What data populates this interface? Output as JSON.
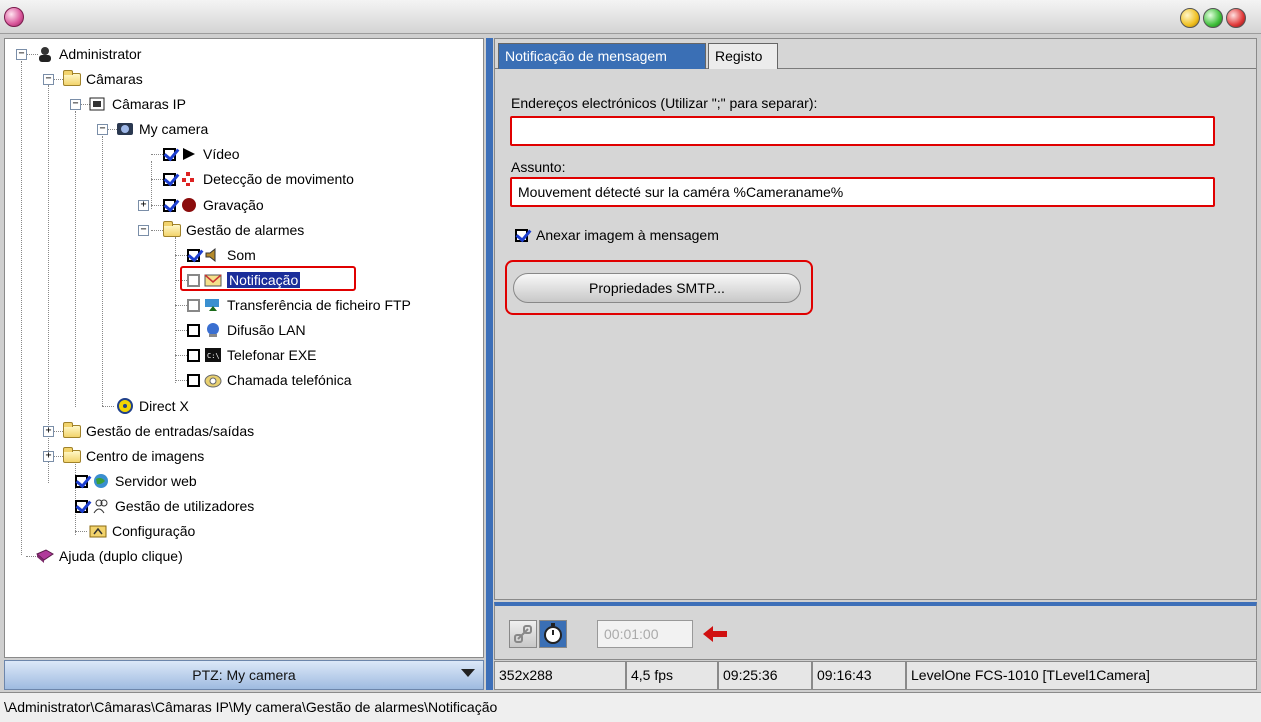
{
  "colors": {
    "accent_blue": "#3d6fb8",
    "highlight_red": "#e00000",
    "check_blue": "#1d3fd0",
    "selection": "#1b2e9a"
  },
  "tree": {
    "items": [
      {
        "label": "Administrator",
        "icon": "administrator-icon"
      },
      {
        "label": "Câmaras",
        "icon": "folder-open-icon"
      },
      {
        "label": "Câmaras IP",
        "icon": "ip-camera-icon"
      },
      {
        "label": "My camera",
        "icon": "camera-icon"
      },
      {
        "label": "Vídeo",
        "icon": "play-icon",
        "checked": true
      },
      {
        "label": "Detecção de movimento",
        "icon": "motion-icon",
        "checked": true
      },
      {
        "label": "Gravação",
        "icon": "record-icon",
        "checked": true
      },
      {
        "label": "Gestão de alarmes",
        "icon": "folder-open-icon"
      },
      {
        "label": "Som",
        "icon": "speaker-icon",
        "checked": true
      },
      {
        "label": "Notificação",
        "icon": "envelope-icon",
        "checked": false,
        "selected": true
      },
      {
        "label": "Transferência de ficheiro FTP",
        "icon": "ftp-icon",
        "checked": false
      },
      {
        "label": "Difusão LAN",
        "icon": "lan-icon",
        "checked": false
      },
      {
        "label": "Telefonar EXE",
        "icon": "console-icon",
        "checked": false
      },
      {
        "label": "Chamada telefónica",
        "icon": "phone-icon",
        "checked": false
      },
      {
        "label": "Direct X",
        "icon": "directx-icon"
      },
      {
        "label": "Gestão de entradas/saídas",
        "icon": "folder-icon"
      },
      {
        "label": "Centro de imagens",
        "icon": "folder-icon"
      },
      {
        "label": "Servidor web",
        "icon": "globe-icon",
        "checked": true
      },
      {
        "label": "Gestão de utilizadores",
        "icon": "users-icon",
        "checked": true
      },
      {
        "label": "Configuração",
        "icon": "config-icon"
      },
      {
        "label": "Ajuda (duplo clique)",
        "icon": "help-book-icon"
      }
    ]
  },
  "ptz": {
    "label": "PTZ: My camera"
  },
  "tabs": [
    {
      "label": "Notificação de mensagem"
    },
    {
      "label": "Registo"
    }
  ],
  "form": {
    "email_label": "Endereços electrónicos (Utilizar \";\" para separar):",
    "email_value": "",
    "subject_label": "Assunto:",
    "subject_value": "Mouvement détecté sur la caméra %Cameraname%",
    "attach_label": "Anexar imagem à mensagem",
    "attach_checked": true,
    "smtp_button": "Propriedades SMTP..."
  },
  "toolbar": {
    "time_value": "00:01:00"
  },
  "status": {
    "resolution": "352x288",
    "fps": "4,5 fps",
    "time1": "09:25:36",
    "time2": "09:16:43",
    "camera_model": "LevelOne FCS-1010 [TLevel1Camera]"
  },
  "path": "\\Administrator\\Câmaras\\Câmaras IP\\My camera\\Gestão de alarmes\\Notificação"
}
